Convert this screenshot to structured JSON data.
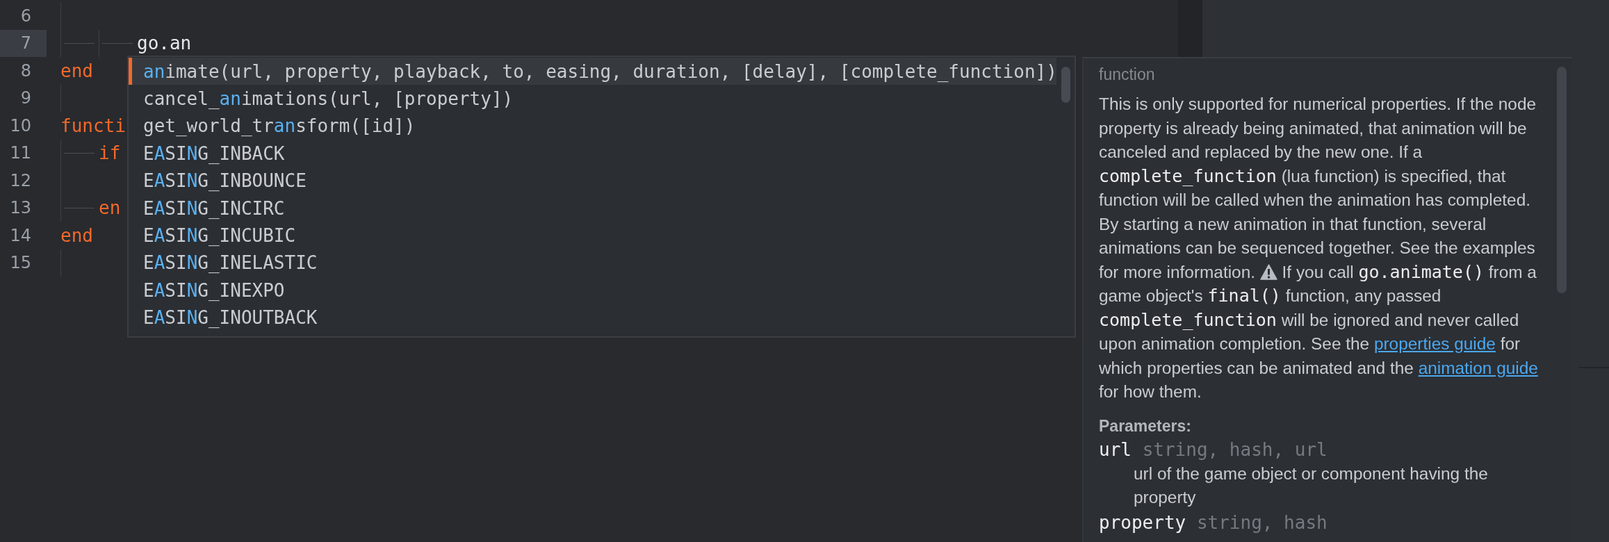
{
  "editor": {
    "lines": [
      {
        "number": "6",
        "current": false
      },
      {
        "number": "7",
        "text": "\t\tgo.an",
        "kind": "plain",
        "current": true
      },
      {
        "number": "8",
        "text": "end",
        "kind": "keyword",
        "current": false
      },
      {
        "number": "9",
        "current": false
      },
      {
        "number": "10",
        "text": "functi",
        "kind": "keyword",
        "current": false
      },
      {
        "number": "11",
        "text": "\tif",
        "kind": "keyword",
        "current": false
      },
      {
        "number": "12",
        "current": false
      },
      {
        "number": "13",
        "text": "\ten",
        "kind": "keyword",
        "current": false
      },
      {
        "number": "14",
        "text": "end",
        "kind": "keyword",
        "current": false
      },
      {
        "number": "15",
        "current": false
      }
    ]
  },
  "completion": {
    "items": [
      {
        "selected": true,
        "parts": [
          {
            "text": "an",
            "match": true
          },
          {
            "text": "imate(url, property, playback, to, easing, duration, [delay], [complete_function])",
            "match": false
          }
        ]
      },
      {
        "selected": false,
        "parts": [
          {
            "text": "cancel_",
            "match": false
          },
          {
            "text": "an",
            "match": true
          },
          {
            "text": "imations(url, [property])",
            "match": false
          }
        ]
      },
      {
        "selected": false,
        "parts": [
          {
            "text": "get_world_tr",
            "match": false
          },
          {
            "text": "an",
            "match": true
          },
          {
            "text": "sform([id])",
            "match": false
          }
        ]
      },
      {
        "selected": false,
        "parts": [
          {
            "text": "E",
            "match": false
          },
          {
            "text": "A",
            "match": true
          },
          {
            "text": "SI",
            "match": false
          },
          {
            "text": "N",
            "match": true
          },
          {
            "text": "G_INBACK",
            "match": false
          }
        ]
      },
      {
        "selected": false,
        "parts": [
          {
            "text": "E",
            "match": false
          },
          {
            "text": "A",
            "match": true
          },
          {
            "text": "SI",
            "match": false
          },
          {
            "text": "N",
            "match": true
          },
          {
            "text": "G_INBOUNCE",
            "match": false
          }
        ]
      },
      {
        "selected": false,
        "parts": [
          {
            "text": "E",
            "match": false
          },
          {
            "text": "A",
            "match": true
          },
          {
            "text": "SI",
            "match": false
          },
          {
            "text": "N",
            "match": true
          },
          {
            "text": "G_INCIRC",
            "match": false
          }
        ]
      },
      {
        "selected": false,
        "parts": [
          {
            "text": "E",
            "match": false
          },
          {
            "text": "A",
            "match": true
          },
          {
            "text": "SI",
            "match": false
          },
          {
            "text": "N",
            "match": true
          },
          {
            "text": "G_INCUBIC",
            "match": false
          }
        ]
      },
      {
        "selected": false,
        "parts": [
          {
            "text": "E",
            "match": false
          },
          {
            "text": "A",
            "match": true
          },
          {
            "text": "SI",
            "match": false
          },
          {
            "text": "N",
            "match": true
          },
          {
            "text": "G_INELASTIC",
            "match": false
          }
        ]
      },
      {
        "selected": false,
        "parts": [
          {
            "text": "E",
            "match": false
          },
          {
            "text": "A",
            "match": true
          },
          {
            "text": "SI",
            "match": false
          },
          {
            "text": "N",
            "match": true
          },
          {
            "text": "G_INEXPO",
            "match": false
          }
        ]
      },
      {
        "selected": false,
        "parts": [
          {
            "text": "E",
            "match": false
          },
          {
            "text": "A",
            "match": true
          },
          {
            "text": "SI",
            "match": false
          },
          {
            "text": "N",
            "match": true
          },
          {
            "text": "G_INOUTBACK",
            "match": false
          }
        ]
      }
    ]
  },
  "documentation": {
    "kind_label": "function",
    "description": [
      {
        "kind": "text",
        "text": "This is only supported for numerical properties. If the node property is already being animated, that animation will be canceled and replaced by the new one. If a "
      },
      {
        "kind": "code",
        "text": "complete_function"
      },
      {
        "kind": "text",
        "text": " (lua function) is specified, that function will be called when the animation has completed. By starting a new animation in that function, several animations can be sequenced together. See the examples for more information. "
      },
      {
        "kind": "warning"
      },
      {
        "kind": "text",
        "text": " If you call "
      },
      {
        "kind": "code",
        "text": "go.animate()"
      },
      {
        "kind": "text",
        "text": " from a game object's "
      },
      {
        "kind": "code",
        "text": "final()"
      },
      {
        "kind": "text",
        "text": " function, any passed "
      },
      {
        "kind": "code",
        "text": "complete_function"
      },
      {
        "kind": "text",
        "text": " will be ignored and never called upon animation completion. See the "
      },
      {
        "kind": "link",
        "text": "properties guide"
      },
      {
        "kind": "text",
        "text": " for which properties can be animated and the "
      },
      {
        "kind": "link",
        "text": "animation guide"
      },
      {
        "kind": "text",
        "text": " for how them."
      }
    ],
    "parameters_heading": "Parameters:",
    "parameters": [
      {
        "name": "url",
        "type": "string, hash, url",
        "description": "url of the game object or component having the property"
      },
      {
        "name": "property",
        "type": "string, hash"
      }
    ]
  }
}
